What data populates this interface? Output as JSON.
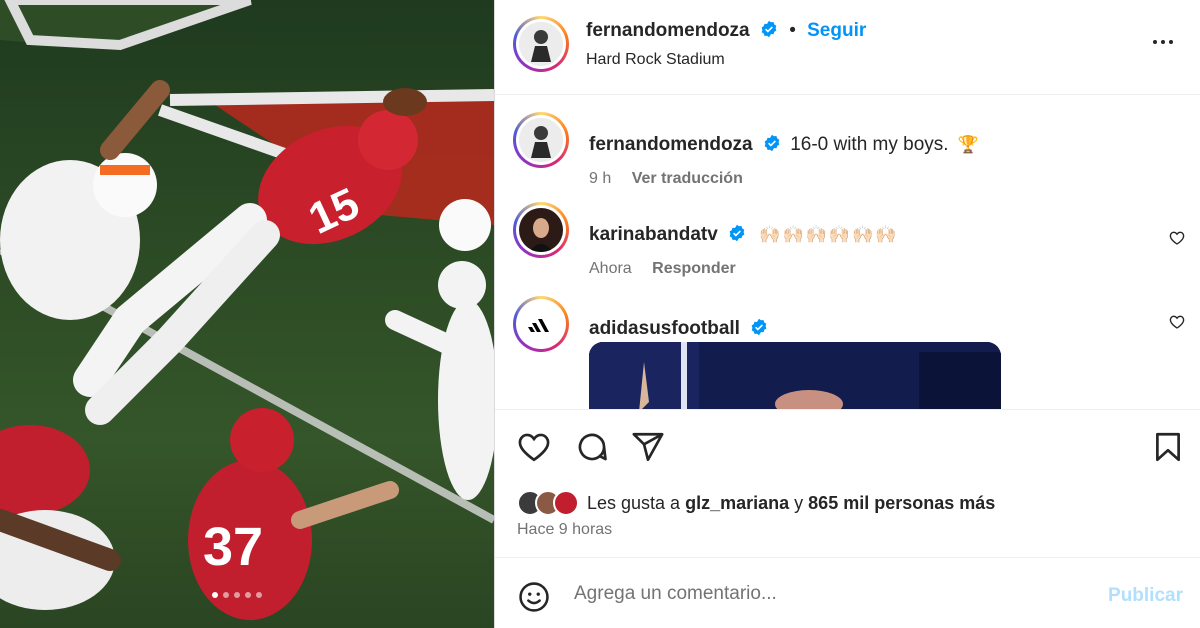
{
  "post": {
    "carousel": {
      "total": 5,
      "active": 0
    }
  },
  "header": {
    "username": "fernandomendoza",
    "separator": "•",
    "follow_label": "Seguir",
    "location": "Hard Rock Stadium",
    "more_icon": "more-horizontal-icon"
  },
  "caption": {
    "username": "fernandomendoza",
    "text": "16-0 with my boys.",
    "emoji": "🏆",
    "time": "9 h",
    "translate_label": "Ver traducción"
  },
  "comments": [
    {
      "username": "karinabandatv",
      "text": "🙌🏻🙌🏻🙌🏻🙌🏻🙌🏻🙌🏻",
      "time": "Ahora",
      "reply_label": "Responder"
    },
    {
      "username": "adidasusfootball",
      "text": "",
      "media": "gif"
    }
  ],
  "actions": {
    "like_icon": "heart-icon",
    "comment_icon": "comment-icon",
    "share_icon": "send-icon",
    "save_icon": "bookmark-icon"
  },
  "likes": {
    "prefix": "Les gusta a",
    "user": "glz_mariana",
    "connector": "y",
    "others": "865 mil personas más"
  },
  "time_ago": "Hace 9 horas",
  "add_comment": {
    "placeholder": "Agrega un comentario...",
    "publish_label": "Publicar"
  },
  "colors": {
    "accent": "#0095f6",
    "publish_disabled": "#b2dffc",
    "verified": "#0095f6",
    "muted": "#737373"
  }
}
